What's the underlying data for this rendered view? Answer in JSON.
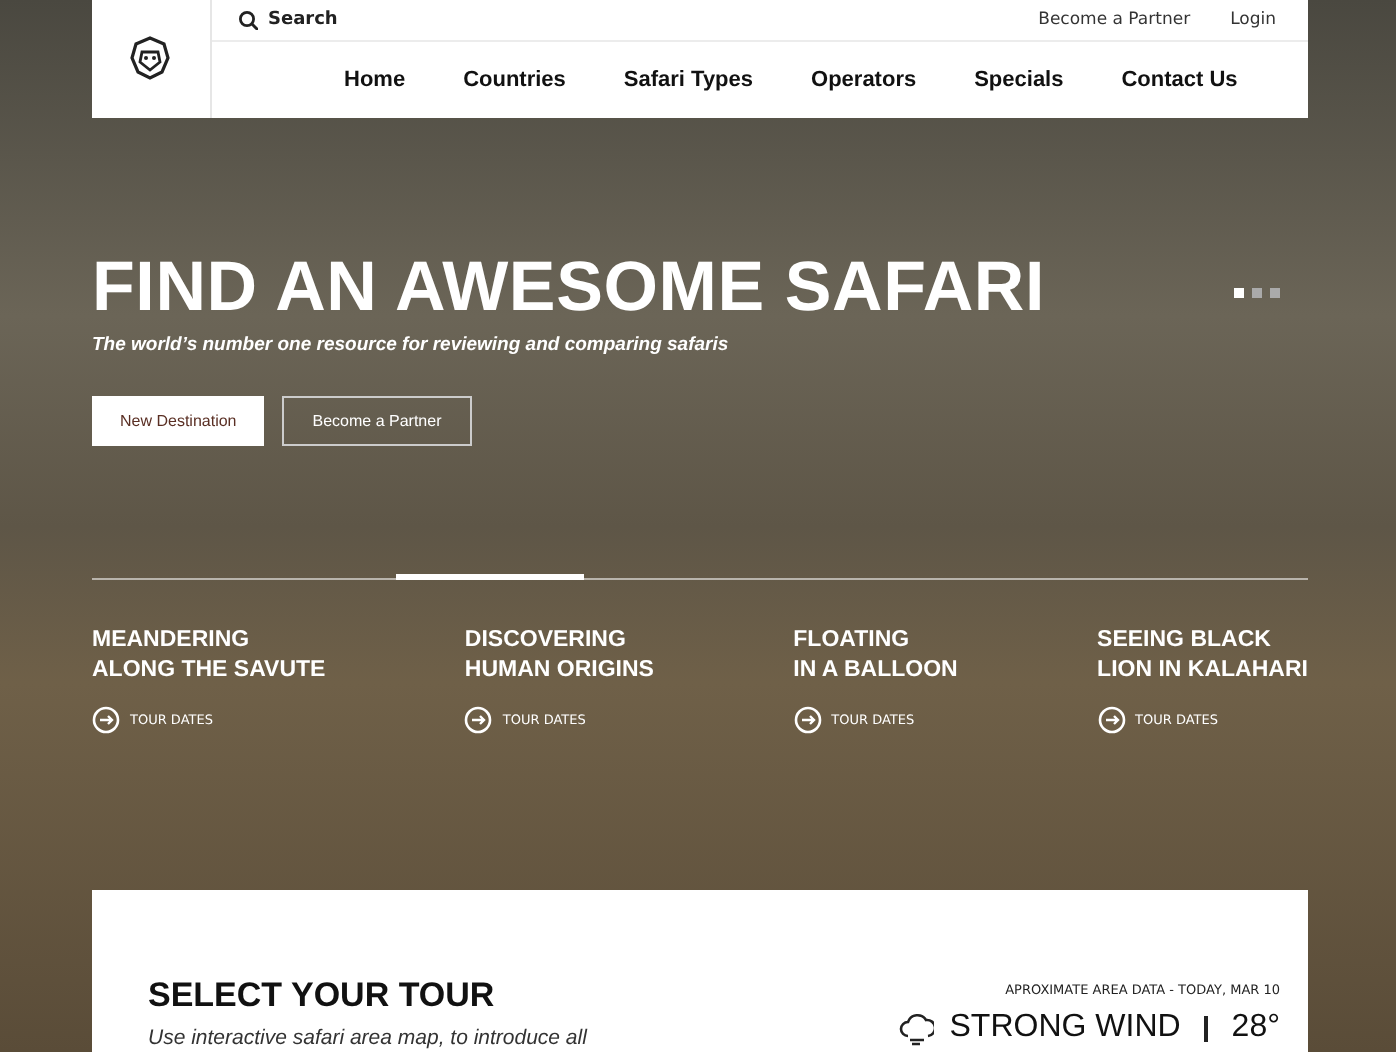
{
  "header": {
    "search": {
      "label": "Search"
    },
    "top_links": [
      "Become a Partner",
      "Login"
    ],
    "nav": [
      "Home",
      "Countries",
      "Safari Types",
      "Operators",
      "Specials",
      "Contact Us"
    ]
  },
  "hero": {
    "title": "FIND AN AWESOME SAFARI",
    "subtitle": "The world’s number one resource for reviewing and comparing safaris",
    "buttons": [
      {
        "label": "New Destination",
        "kind": "solid"
      },
      {
        "label": "Become a Partner",
        "kind": "outline"
      }
    ],
    "slides": [
      {
        "selected": true
      },
      {
        "selected": false
      },
      {
        "selected": false
      }
    ]
  },
  "stories": [
    {
      "title_lines": [
        "MEANDERING",
        "ALONG THE SAVUTE"
      ],
      "link": "TOUR DATES",
      "selected": false
    },
    {
      "title_lines": [
        "DISCOVERING",
        "HUMAN ORIGINS"
      ],
      "link": "TOUR DATES",
      "selected": true
    },
    {
      "title_lines": [
        "FLOATING",
        "IN A BALLOON"
      ],
      "link": "TOUR DATES",
      "selected": false
    },
    {
      "title_lines": [
        "SEEING BLACK",
        "LION IN KALAHARI"
      ],
      "link": "TOUR DATES",
      "selected": false
    }
  ],
  "tour_panel": {
    "title": "SELECT YOUR TOUR",
    "text": "Use interactive safari area map, to introduce all",
    "weather": {
      "caption": "APROXIMATE AREA DATA - TODAY, MAR 10",
      "condition": "STRONG WIND",
      "temperature": "28°"
    }
  }
}
